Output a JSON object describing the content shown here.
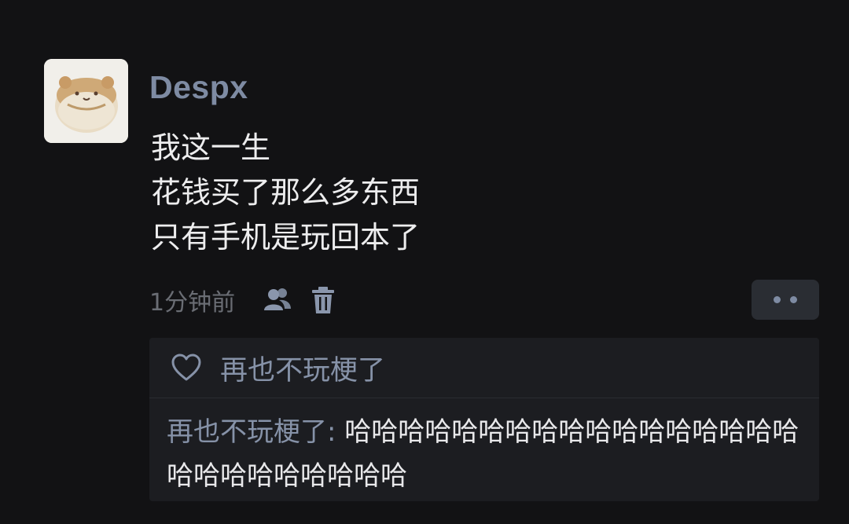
{
  "post": {
    "username": "Despx",
    "avatar_icon": "bear-bun-avatar-icon",
    "lines": [
      "我这一生",
      "花钱买了那么多东西",
      "只有手机是玩回本了"
    ],
    "timestamp": "1分钟前",
    "actions": {
      "share_icon": "users-icon",
      "delete_icon": "trash-icon",
      "more_icon": "more-dots-icon"
    }
  },
  "likes": {
    "icon": "heart-icon",
    "name": "再也不玩梗了"
  },
  "comment": {
    "author": "再也不玩梗了:",
    "text": "哈哈哈哈哈哈哈哈哈哈哈哈哈哈哈哈哈哈哈哈哈哈哈哈哈哈"
  },
  "colors": {
    "background": "#121214",
    "username": "#7e8ba3",
    "muted": "#6a6d74",
    "panel": "#1c1d21",
    "link": "#8692a8"
  }
}
